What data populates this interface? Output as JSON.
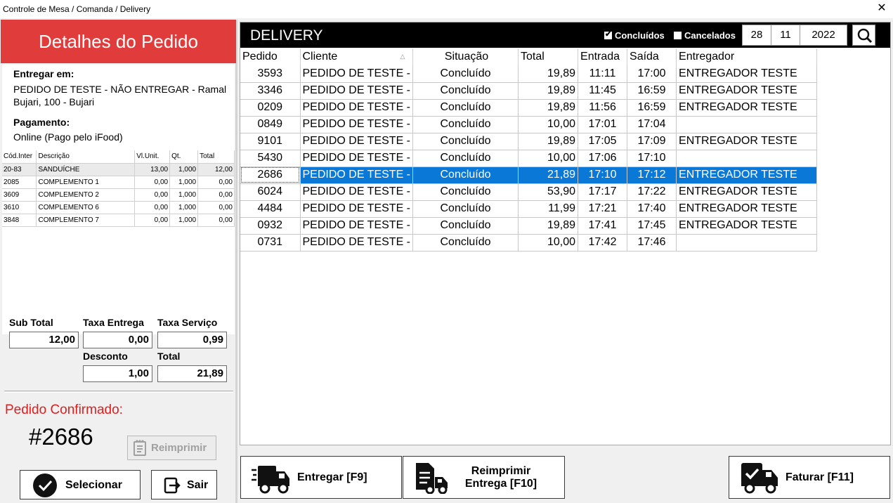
{
  "window": {
    "title": "Controle de Mesa / Comanda / Delivery",
    "close": "✕"
  },
  "details": {
    "heading": "Detalhes do Pedido",
    "deliver_label": "Entregar em:",
    "deliver_line1": "PEDIDO DE TESTE - NÃO ENTREGAR - Ramal",
    "deliver_line2": "Bujari, 100 - Bujari",
    "payment_label": "Pagamento:",
    "payment_value": "Online (Pago pelo iFood)",
    "items_headers": [
      "Cód.Inter",
      "Descrição",
      "Vl.Unit.",
      "Qt.",
      "Total"
    ],
    "items": [
      [
        "20-83",
        "SANDUÍCHE",
        "13,00",
        "1,000",
        "12,00"
      ],
      [
        "2085",
        "COMPLEMENTO 1",
        "0,00",
        "1,000",
        "0,00"
      ],
      [
        "3609",
        "COMPLEMENTO 2",
        "0,00",
        "1,000",
        "0,00"
      ],
      [
        "3610",
        "COMPLEMENTO 6",
        "0,00",
        "1,000",
        "0,00"
      ],
      [
        "3848",
        "COMPLEMENTO 7",
        "0,00",
        "1,000",
        "0,00"
      ]
    ],
    "totals": {
      "subtotal_label": "Sub Total",
      "subtotal": "12,00",
      "taxa_entrega_label": "Taxa Entrega",
      "taxa_entrega": "0,00",
      "taxa_servico_label": "Taxa Serviço",
      "taxa_servico": "0,99",
      "desconto_label": "Desconto",
      "desconto": "1,00",
      "total_label": "Total",
      "total": "21,89"
    },
    "confirmed_label": "Pedido Confirmado:",
    "order_number": "#2686",
    "reprint_label": "Reimprimir",
    "select_label": "Selecionar",
    "exit_label": "Sair"
  },
  "delivery": {
    "title": "DELIVERY",
    "filter_concluidos": "Concluídos",
    "filter_concluidos_checked": true,
    "filter_cancelados": "Cancelados",
    "filter_cancelados_checked": false,
    "day": "28",
    "month": "11",
    "year": "2022",
    "columns": [
      "Pedido",
      "Cliente",
      "Situação",
      "Total",
      "Entrada",
      "Saída",
      "Entregador"
    ],
    "rows": [
      [
        "3593",
        "PEDIDO DE TESTE -",
        "Concluído",
        "19,89",
        "11:11",
        "17:00",
        "ENTREGADOR TESTE"
      ],
      [
        "3346",
        "PEDIDO DE TESTE -",
        "Concluído",
        "19,89",
        "11:45",
        "16:59",
        "ENTREGADOR TESTE"
      ],
      [
        "0209",
        "PEDIDO DE TESTE -",
        "Concluído",
        "19,89",
        "11:56",
        "16:59",
        "ENTREGADOR TESTE"
      ],
      [
        "0849",
        "PEDIDO DE TESTE -",
        "Concluído",
        "10,00",
        "17:01",
        "17:04",
        ""
      ],
      [
        "9101",
        "PEDIDO DE TESTE -",
        "Concluído",
        "19,89",
        "17:05",
        "17:09",
        "ENTREGADOR TESTE"
      ],
      [
        "5430",
        "PEDIDO DE TESTE -",
        "Concluído",
        "10,00",
        "17:06",
        "17:10",
        ""
      ],
      [
        "2686",
        "PEDIDO DE TESTE -",
        "Concluído",
        "21,89",
        "17:10",
        "17:12",
        "ENTREGADOR TESTE"
      ],
      [
        "6024",
        "PEDIDO DE TESTE -",
        "Concluído",
        "53,90",
        "17:17",
        "17:22",
        "ENTREGADOR TESTE"
      ],
      [
        "4484",
        "PEDIDO DE TESTE -",
        "Concluído",
        "11,99",
        "17:21",
        "17:40",
        "ENTREGADOR TESTE"
      ],
      [
        "0932",
        "PEDIDO DE TESTE -",
        "Concluído",
        "19,89",
        "17:41",
        "17:45",
        "ENTREGADOR TESTE"
      ],
      [
        "0731",
        "PEDIDO DE TESTE -",
        "Concluído",
        "10,00",
        "17:42",
        "17:46",
        ""
      ]
    ],
    "selected_order": "2686"
  },
  "actions": {
    "entregar": "Entregar [F9]",
    "reimprimir_line1": "Reimprimir",
    "reimprimir_line2": "Entrega [F10]",
    "faturar": "Faturar [F11]"
  },
  "colors": {
    "header_red": "#e03c3c",
    "selection_blue": "#0a78d7",
    "confirmed_red": "#e01e1e"
  }
}
